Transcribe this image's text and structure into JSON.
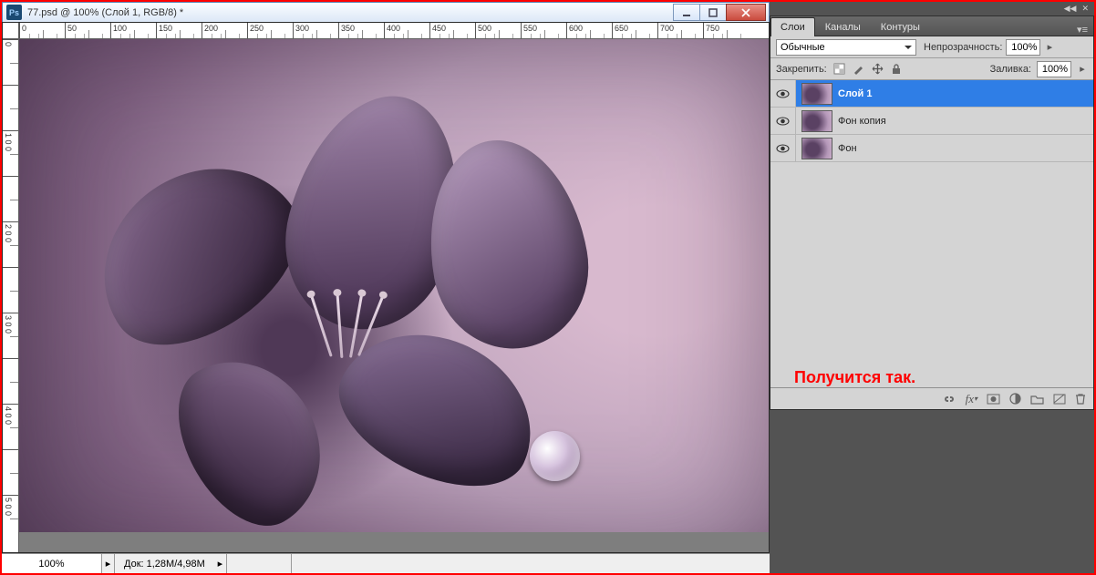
{
  "window": {
    "title": "77.psd @ 100% (Слой 1, RGB/8) *",
    "app_badge": "Ps"
  },
  "ruler_h": [
    "0",
    "50",
    "100",
    "150",
    "200",
    "250",
    "300",
    "350",
    "400",
    "450",
    "500",
    "550",
    "600",
    "650",
    "700",
    "750"
  ],
  "ruler_v": [
    "0",
    "",
    "1 0 0",
    "",
    "2 0 0",
    "",
    "3 0 0",
    "",
    "4 0 0",
    "",
    "5 0 0"
  ],
  "status": {
    "zoom": "100%",
    "doc_info": "Док: 1,28M/4,98M"
  },
  "tabs": [
    {
      "label": "Слои",
      "active": true
    },
    {
      "label": "Каналы",
      "active": false
    },
    {
      "label": "Контуры",
      "active": false
    }
  ],
  "blend_mode": "Обычные",
  "opacity": {
    "label": "Непрозрачность:",
    "value": "100%"
  },
  "lock": {
    "label": "Закрепить:"
  },
  "fill": {
    "label": "Заливка:",
    "value": "100%"
  },
  "layers": [
    {
      "name": "Слой 1",
      "selected": true
    },
    {
      "name": "Фон копия",
      "selected": false
    },
    {
      "name": "Фон",
      "selected": false
    }
  ],
  "annotation": "Получится так."
}
